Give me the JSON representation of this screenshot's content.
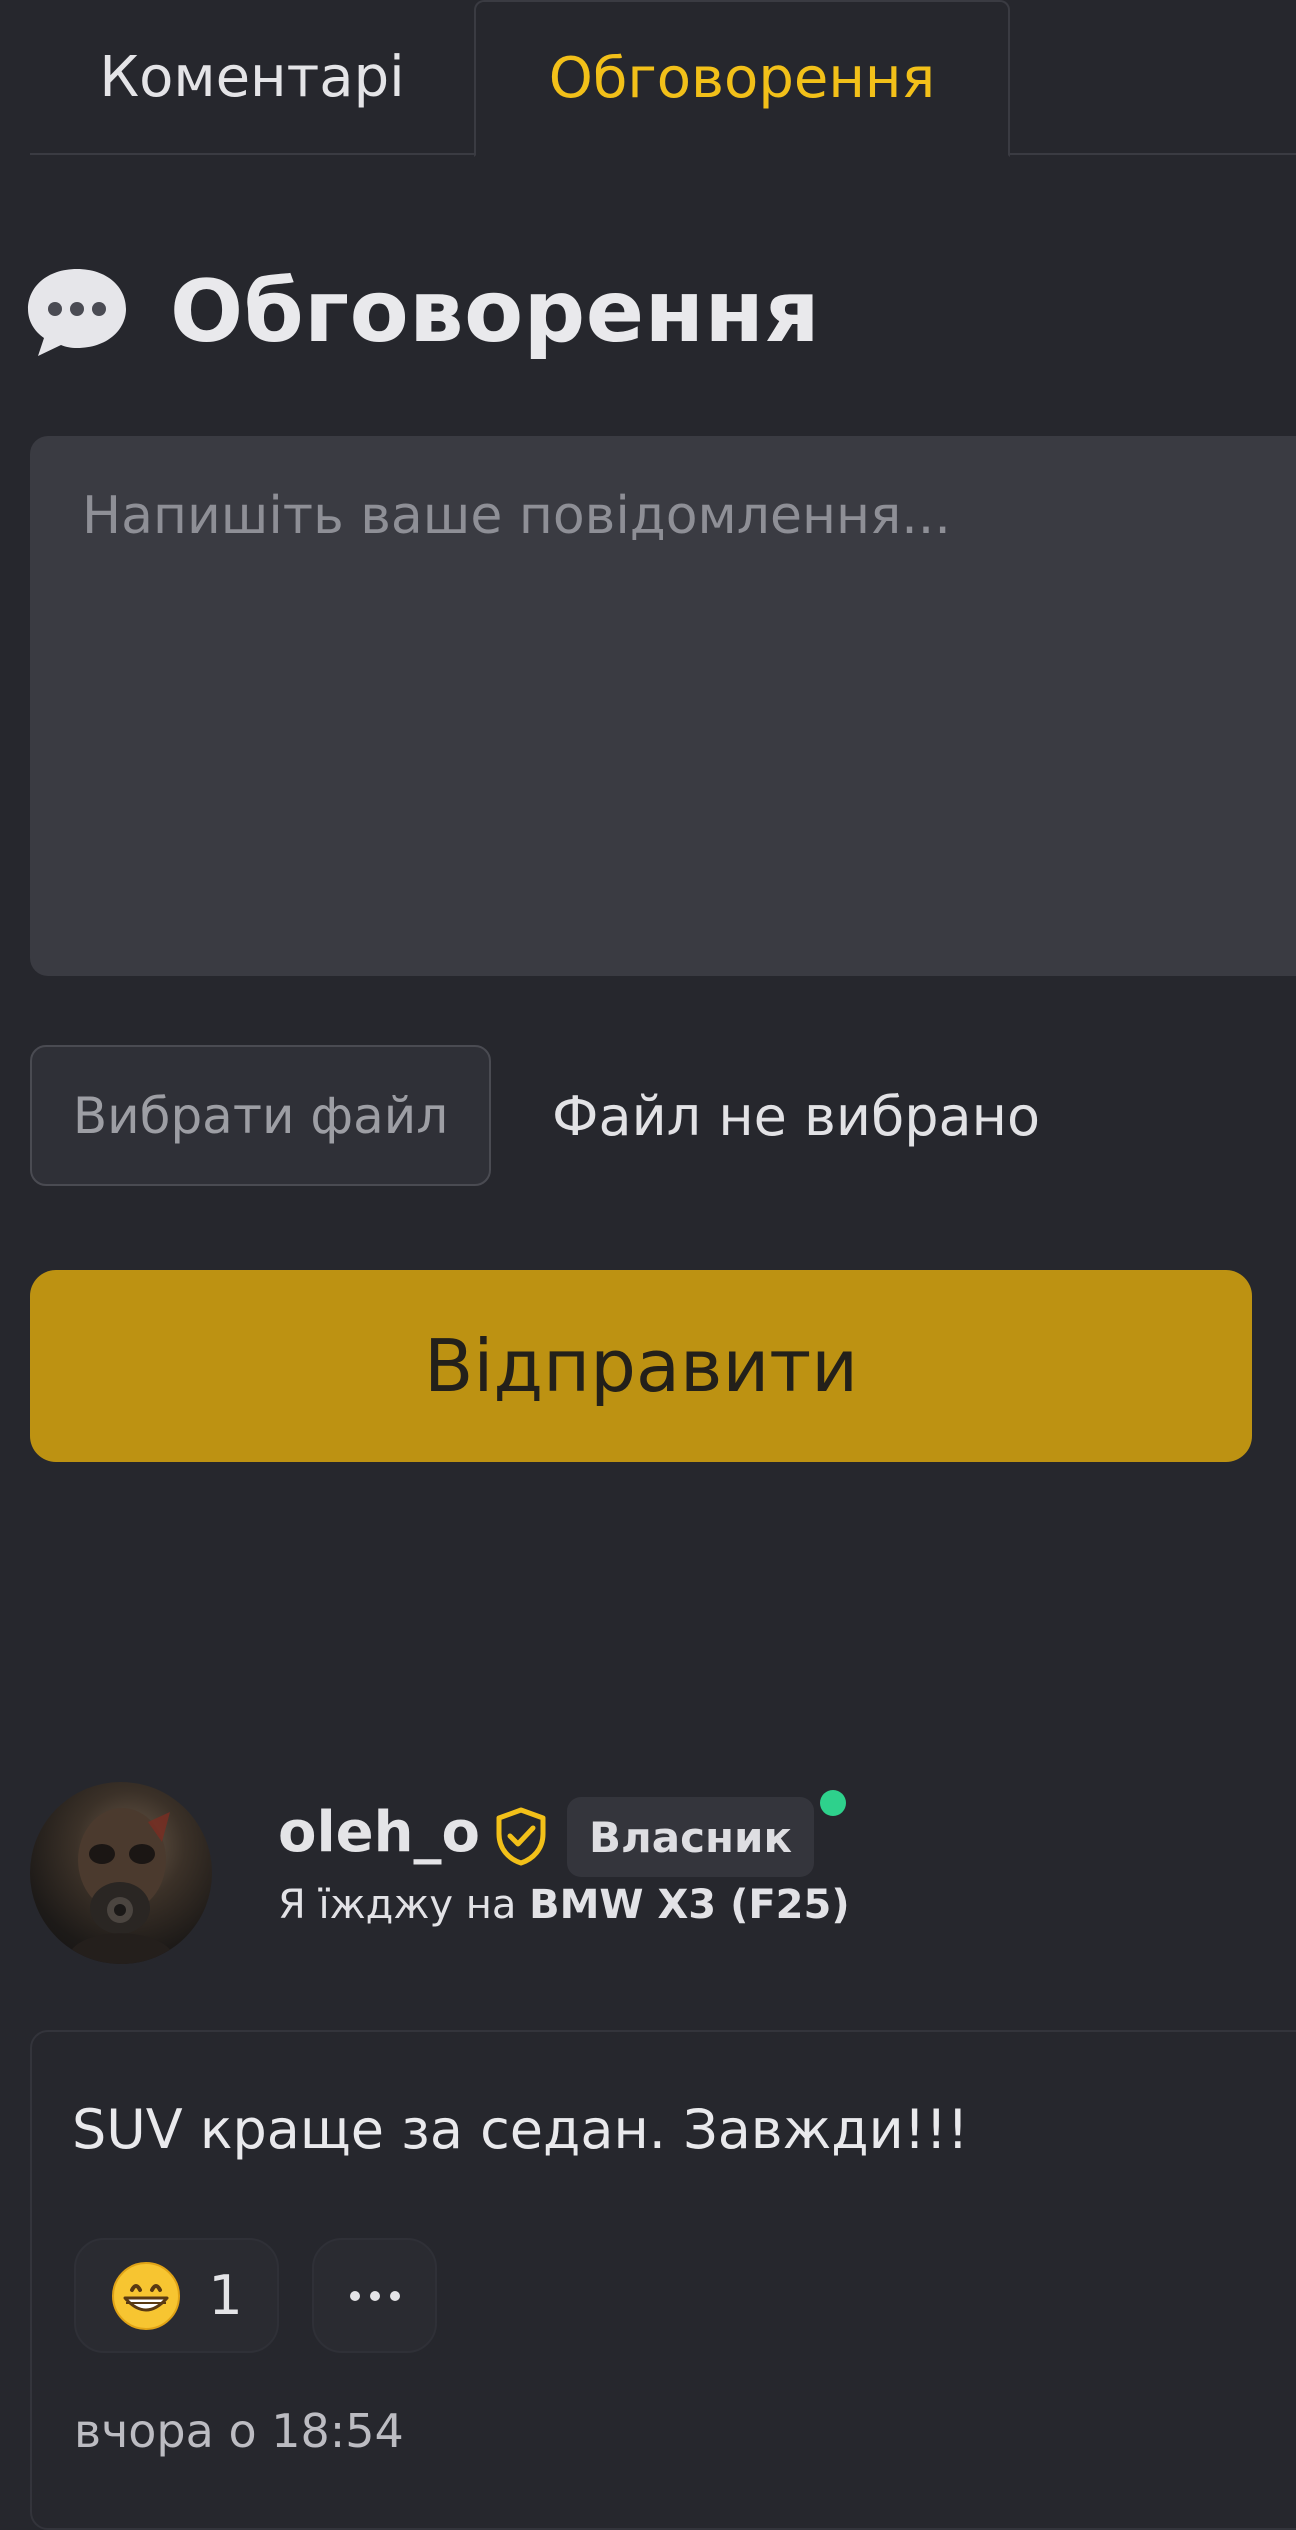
{
  "tabs": [
    {
      "label": "Коментарі",
      "active": false
    },
    {
      "label": "Обговорення",
      "active": true
    }
  ],
  "heading": {
    "title": "Обговорення",
    "icon": "speech-bubble-icon"
  },
  "composer": {
    "placeholder": "Напишіть ваше повідомлення...",
    "value": "",
    "file_button_label": "Вибрати файл",
    "file_status": "Файл не вибрано",
    "send_label": "Відправити"
  },
  "post": {
    "username": "oleh_o",
    "role": "Власник",
    "online": true,
    "car_prefix": "Я їжджу на",
    "car_model": "BMW X3 (F25)",
    "text": "SUV краще за седан. Завжди!!!",
    "reaction_emoji": "grinning-face-icon",
    "reaction_count": "1",
    "timestamp": "вчора о 18:54"
  },
  "colors": {
    "background": "#26272d",
    "accent": "#f2c019",
    "send_button": "#bd9212",
    "input_bg": "#3a3b42",
    "online": "#2ed18c"
  }
}
